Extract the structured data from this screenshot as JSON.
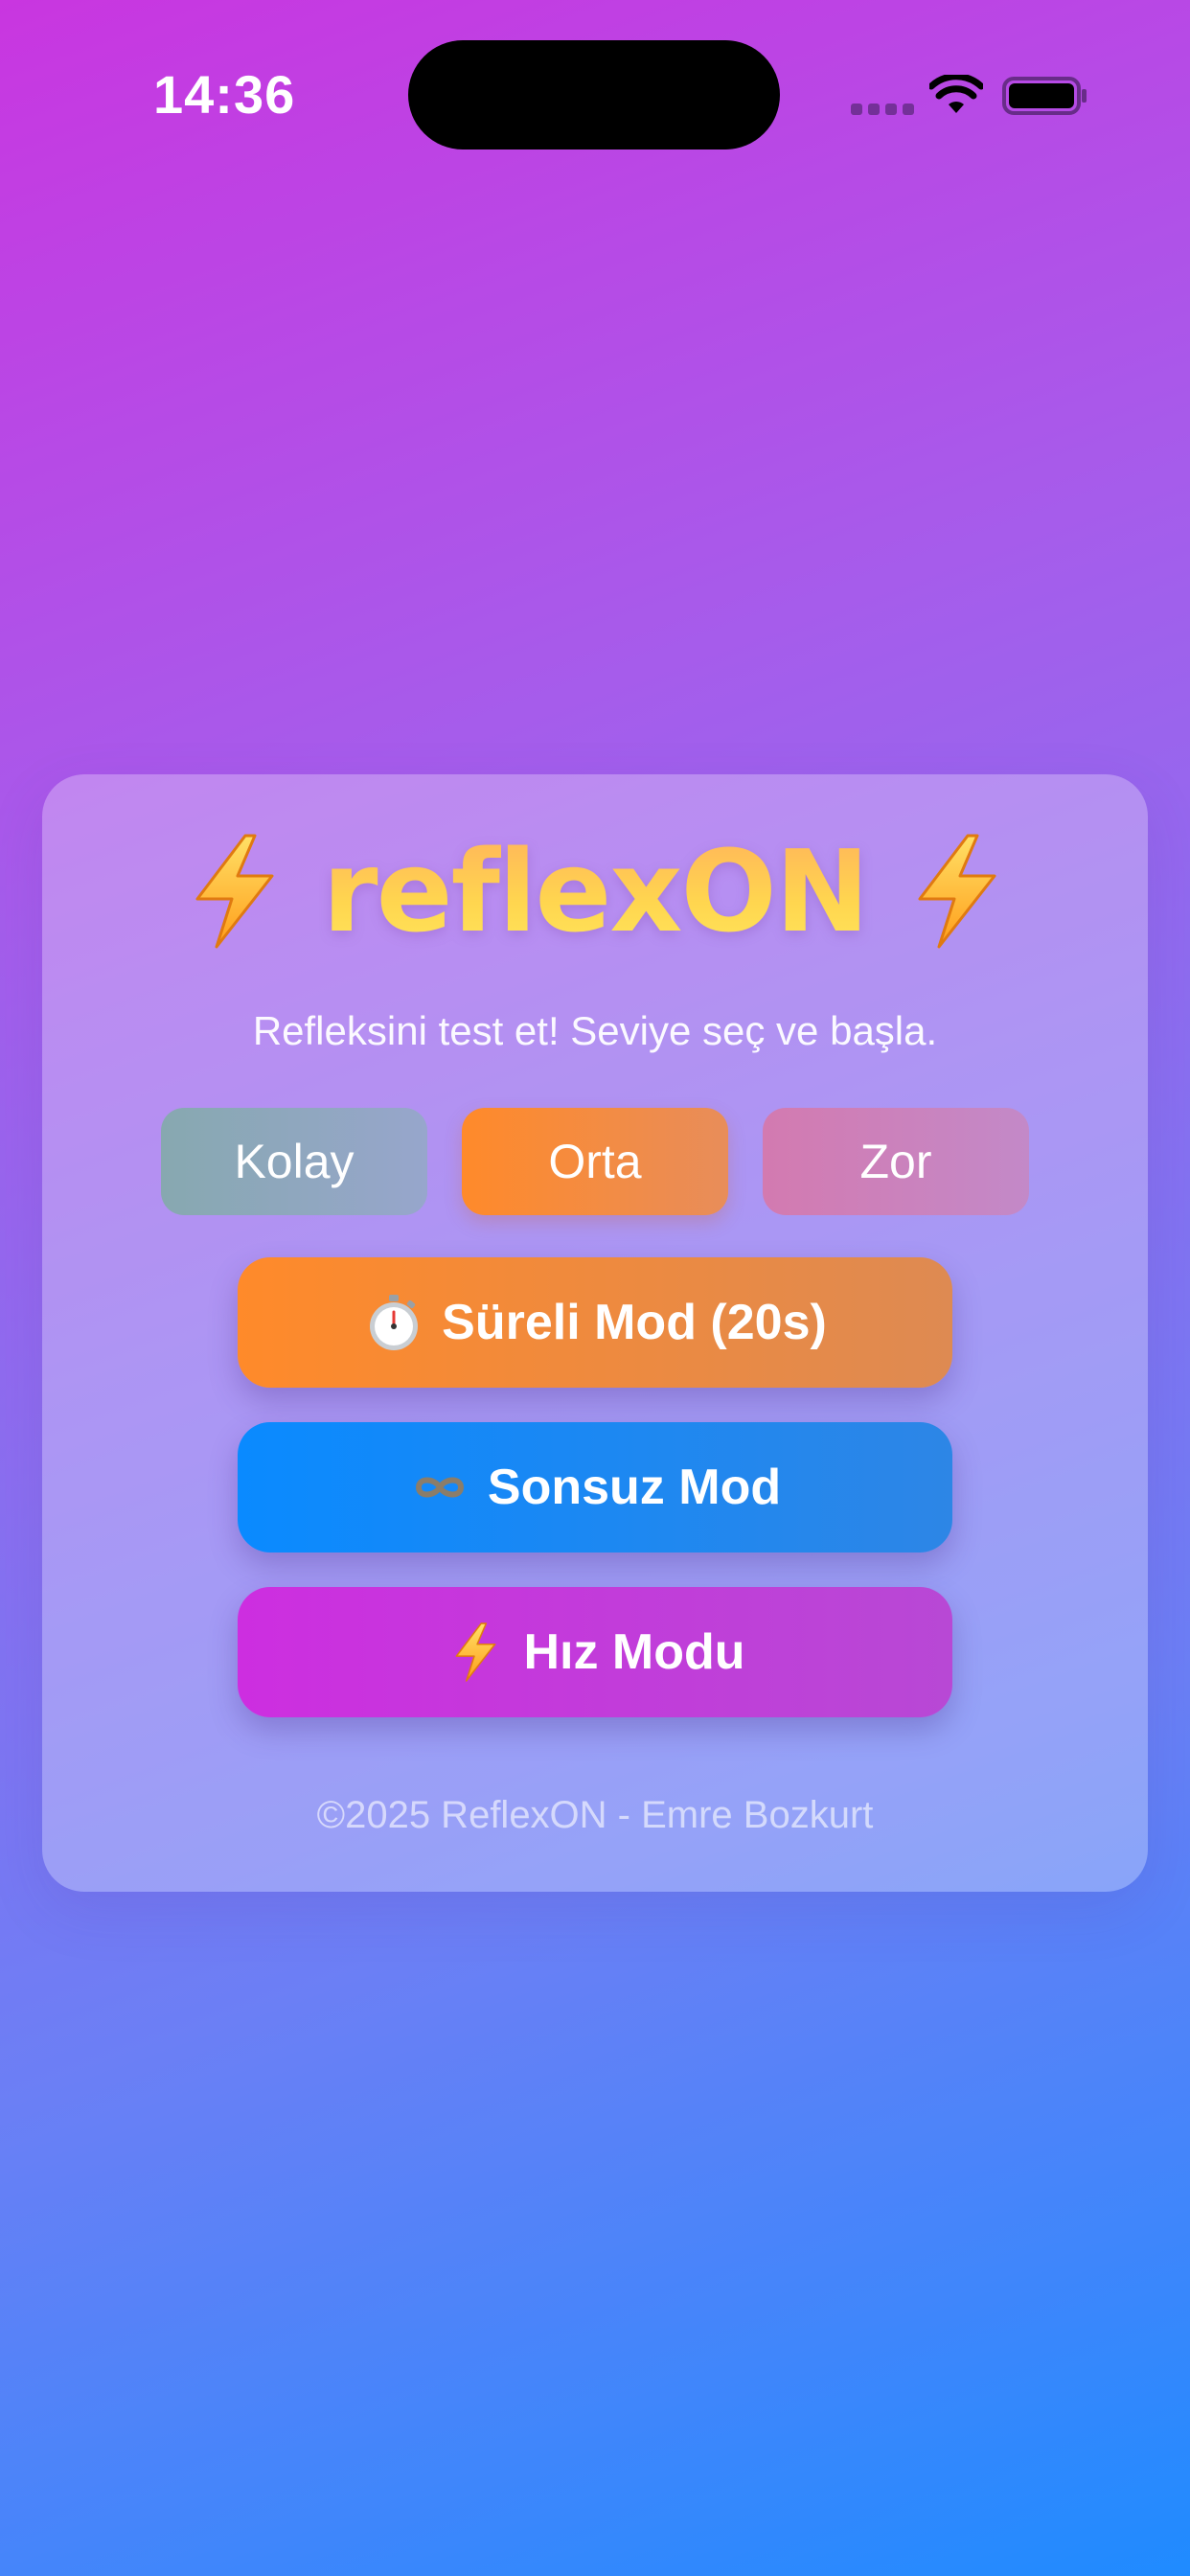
{
  "status_bar": {
    "time": "14:36"
  },
  "app": {
    "title": "reflexON",
    "title_icon": "lightning-icon",
    "subtitle": "Refleksini test et! Seviye seç ve başla.",
    "levels": [
      {
        "label": "Kolay"
      },
      {
        "label": "Orta",
        "selected": true
      },
      {
        "label": "Zor"
      }
    ],
    "modes": [
      {
        "icon": "stopwatch-icon",
        "label": "Süreli Mod (20s)",
        "color": "#ff8a2a"
      },
      {
        "icon": "infinity-icon",
        "label": "Sonsuz Mod",
        "color": "#0a8aff"
      },
      {
        "icon": "lightning-icon",
        "label": "Hız Modu",
        "color": "#cd2ee0"
      }
    ],
    "footer": "©2025 ReflexON - Emre Bozkurt"
  },
  "colors": {
    "accent_gold": "#ffd54a",
    "gradient_top": "#c936e0",
    "gradient_bottom": "#1f8bff"
  }
}
